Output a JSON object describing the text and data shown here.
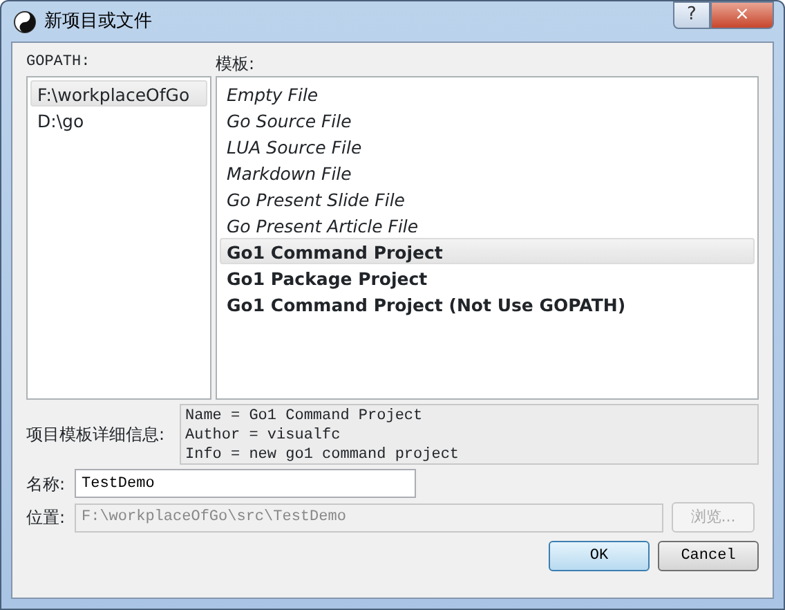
{
  "window": {
    "title": "新项目或文件",
    "buttons": [
      "?",
      "×"
    ]
  },
  "gopath": {
    "label": "GOPATH:",
    "items": [
      {
        "text": "F:\\workplaceOfGo",
        "selected": true
      },
      {
        "text": "D:\\go",
        "selected": false
      }
    ]
  },
  "templates": {
    "label": "模板:",
    "items": [
      {
        "text": "Empty File",
        "kind": "file",
        "selected": false
      },
      {
        "text": "Go Source File",
        "kind": "file",
        "selected": false
      },
      {
        "text": "LUA Source File",
        "kind": "file",
        "selected": false
      },
      {
        "text": "Markdown File",
        "kind": "file",
        "selected": false
      },
      {
        "text": "Go Present Slide File",
        "kind": "file",
        "selected": false
      },
      {
        "text": "Go Present Article File",
        "kind": "file",
        "selected": false
      },
      {
        "text": "Go1 Command Project",
        "kind": "project",
        "selected": true
      },
      {
        "text": "Go1 Package Project",
        "kind": "project",
        "selected": false
      },
      {
        "text": "Go1 Command Project (Not Use GOPATH)",
        "kind": "project",
        "selected": false
      }
    ]
  },
  "details": {
    "label": "项目模板详细信息:",
    "lines": [
      "Name = Go1 Command Project",
      "Author = visualfc",
      "Info = new go1 command project"
    ]
  },
  "name_field": {
    "label": "名称:",
    "value": "TestDemo"
  },
  "location_field": {
    "label": "位置:",
    "value": "F:\\workplaceOfGo\\src\\TestDemo",
    "disabled": true
  },
  "browse_button": {
    "label": "浏览...",
    "disabled": true
  },
  "buttons": [
    {
      "label": "OK",
      "default": true
    },
    {
      "label": "Cancel",
      "default": false
    }
  ]
}
